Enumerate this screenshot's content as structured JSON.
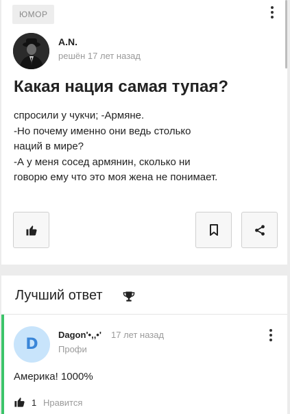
{
  "question": {
    "category": "ЮМОР",
    "author": {
      "name": "A.N.",
      "meta": "решён 17 лет назад"
    },
    "title": "Какая нация самая тупая?",
    "body": "спросили у чукчи; -Армяне.\n-Но почему именно они ведь столько наций в мире?\n-А у меня сосед армянин, сколько ни говорю ему что это моя жена не понимает.",
    "icons": {
      "more": "more-vertical-icon",
      "like": "thumbs-up-icon",
      "bookmark": "bookmark-icon",
      "share": "share-icon"
    }
  },
  "best_answer": {
    "heading": "Лучший ответ",
    "heading_icon": "trophy-icon",
    "accent_color": "#3cc46a",
    "author": {
      "initial": "D",
      "name": "Dagon'•,,•'",
      "time": "17 лет назад",
      "rank": "Профи"
    },
    "text": "Америка! 1000%",
    "likes": {
      "count": "1",
      "label": "Нравится"
    }
  }
}
